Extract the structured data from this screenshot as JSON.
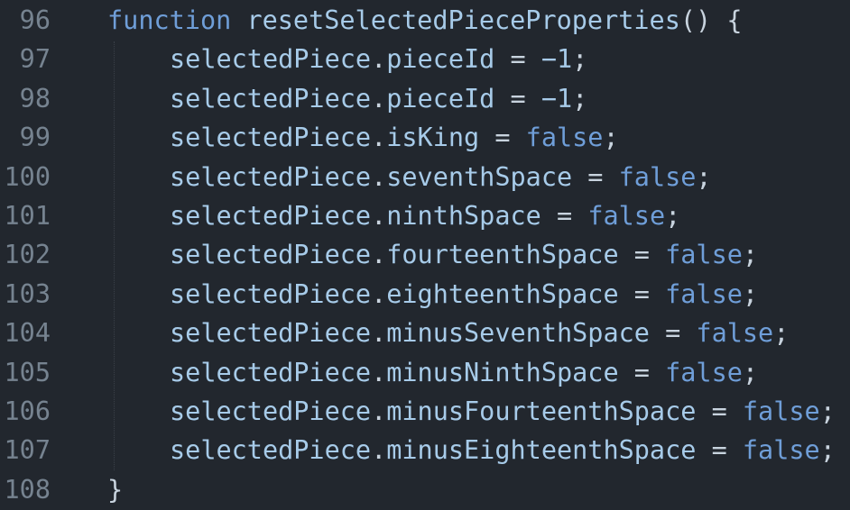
{
  "editor": {
    "lines": [
      {
        "number": "96",
        "indent": 0,
        "tokens": [
          {
            "cls": "kw",
            "text": "function"
          },
          {
            "cls": "fn",
            "text": " resetSelectedPieceProperties"
          },
          {
            "cls": "punc",
            "text": "() {"
          }
        ]
      },
      {
        "number": "97",
        "indent": 1,
        "tokens": [
          {
            "cls": "prop",
            "text": "selectedPiece"
          },
          {
            "cls": "punc",
            "text": "."
          },
          {
            "cls": "prop",
            "text": "pieceId"
          },
          {
            "cls": "op",
            "text": " = "
          },
          {
            "cls": "num",
            "text": "−1"
          },
          {
            "cls": "punc",
            "text": ";"
          }
        ]
      },
      {
        "number": "98",
        "indent": 1,
        "tokens": [
          {
            "cls": "prop",
            "text": "selectedPiece"
          },
          {
            "cls": "punc",
            "text": "."
          },
          {
            "cls": "prop",
            "text": "pieceId"
          },
          {
            "cls": "op",
            "text": " = "
          },
          {
            "cls": "num",
            "text": "−1"
          },
          {
            "cls": "punc",
            "text": ";"
          }
        ]
      },
      {
        "number": "99",
        "indent": 1,
        "tokens": [
          {
            "cls": "prop",
            "text": "selectedPiece"
          },
          {
            "cls": "punc",
            "text": "."
          },
          {
            "cls": "prop",
            "text": "isKing"
          },
          {
            "cls": "op",
            "text": " = "
          },
          {
            "cls": "bool",
            "text": "false"
          },
          {
            "cls": "punc",
            "text": ";"
          }
        ]
      },
      {
        "number": "100",
        "indent": 1,
        "tokens": [
          {
            "cls": "prop",
            "text": "selectedPiece"
          },
          {
            "cls": "punc",
            "text": "."
          },
          {
            "cls": "prop",
            "text": "seventhSpace"
          },
          {
            "cls": "op",
            "text": " = "
          },
          {
            "cls": "bool",
            "text": "false"
          },
          {
            "cls": "punc",
            "text": ";"
          }
        ]
      },
      {
        "number": "101",
        "indent": 1,
        "tokens": [
          {
            "cls": "prop",
            "text": "selectedPiece"
          },
          {
            "cls": "punc",
            "text": "."
          },
          {
            "cls": "prop",
            "text": "ninthSpace"
          },
          {
            "cls": "op",
            "text": " = "
          },
          {
            "cls": "bool",
            "text": "false"
          },
          {
            "cls": "punc",
            "text": ";"
          }
        ]
      },
      {
        "number": "102",
        "indent": 1,
        "tokens": [
          {
            "cls": "prop",
            "text": "selectedPiece"
          },
          {
            "cls": "punc",
            "text": "."
          },
          {
            "cls": "prop",
            "text": "fourteenthSpace"
          },
          {
            "cls": "op",
            "text": " = "
          },
          {
            "cls": "bool",
            "text": "false"
          },
          {
            "cls": "punc",
            "text": ";"
          }
        ]
      },
      {
        "number": "103",
        "indent": 1,
        "tokens": [
          {
            "cls": "prop",
            "text": "selectedPiece"
          },
          {
            "cls": "punc",
            "text": "."
          },
          {
            "cls": "prop",
            "text": "eighteenthSpace"
          },
          {
            "cls": "op",
            "text": " = "
          },
          {
            "cls": "bool",
            "text": "false"
          },
          {
            "cls": "punc",
            "text": ";"
          }
        ]
      },
      {
        "number": "104",
        "indent": 1,
        "tokens": [
          {
            "cls": "prop",
            "text": "selectedPiece"
          },
          {
            "cls": "punc",
            "text": "."
          },
          {
            "cls": "prop",
            "text": "minusSeventhSpace"
          },
          {
            "cls": "op",
            "text": " = "
          },
          {
            "cls": "bool",
            "text": "false"
          },
          {
            "cls": "punc",
            "text": ";"
          }
        ]
      },
      {
        "number": "105",
        "indent": 1,
        "tokens": [
          {
            "cls": "prop",
            "text": "selectedPiece"
          },
          {
            "cls": "punc",
            "text": "."
          },
          {
            "cls": "prop",
            "text": "minusNinthSpace"
          },
          {
            "cls": "op",
            "text": " = "
          },
          {
            "cls": "bool",
            "text": "false"
          },
          {
            "cls": "punc",
            "text": ";"
          }
        ]
      },
      {
        "number": "106",
        "indent": 1,
        "tokens": [
          {
            "cls": "prop",
            "text": "selectedPiece"
          },
          {
            "cls": "punc",
            "text": "."
          },
          {
            "cls": "prop",
            "text": "minusFourteenthSpace"
          },
          {
            "cls": "op",
            "text": " = "
          },
          {
            "cls": "bool",
            "text": "false"
          },
          {
            "cls": "punc",
            "text": ";"
          }
        ]
      },
      {
        "number": "107",
        "indent": 1,
        "tokens": [
          {
            "cls": "prop",
            "text": "selectedPiece"
          },
          {
            "cls": "punc",
            "text": "."
          },
          {
            "cls": "prop",
            "text": "minusEighteenthSpace"
          },
          {
            "cls": "op",
            "text": " = "
          },
          {
            "cls": "bool",
            "text": "false"
          },
          {
            "cls": "punc",
            "text": ";"
          }
        ]
      },
      {
        "number": "108",
        "indent": 0,
        "tokens": [
          {
            "cls": "punc",
            "text": "}"
          }
        ]
      }
    ]
  },
  "colors": {
    "background": "#22272e",
    "line_number": "#768390",
    "keyword": "#6f9ed8",
    "identifier": "#a7cbe9",
    "punctuation": "#c8d3de"
  }
}
